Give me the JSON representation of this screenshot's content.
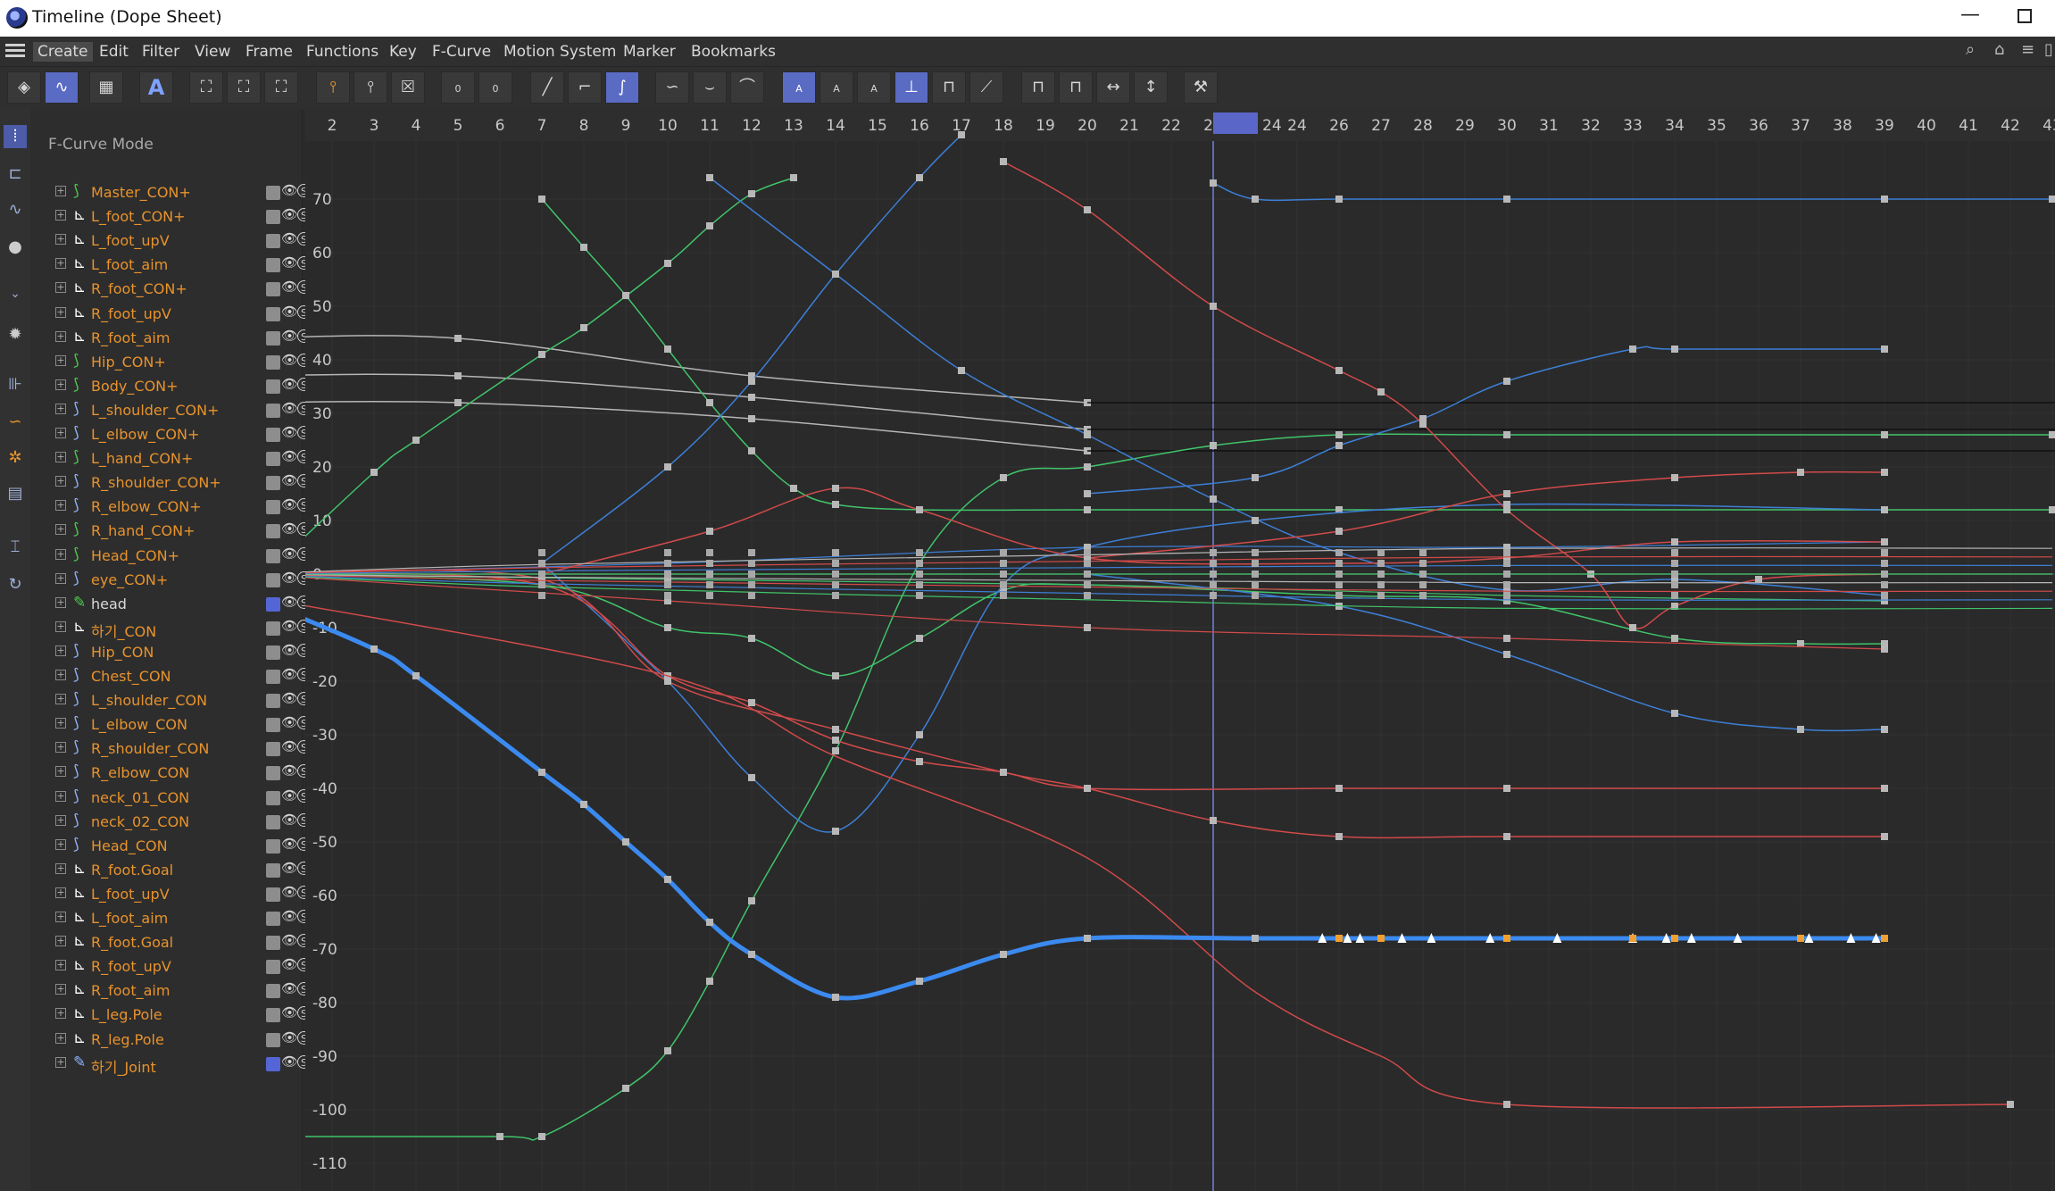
{
  "window": {
    "title": "Timeline (Dope Sheet)"
  },
  "menu": [
    "Create",
    "Edit",
    "Filter",
    "View",
    "Frame",
    "Functions",
    "Key",
    "F-Curve",
    "Motion System",
    "Marker",
    "Bookmarks"
  ],
  "panel": {
    "mode_label": "F-Curve Mode",
    "tracks": [
      {
        "name": "Master_CON+",
        "icon": "spline-icon",
        "color": "#4ccc4c",
        "sq": "grey"
      },
      {
        "name": "L_foot_CON+",
        "icon": "null-icon",
        "color": "#ffffff",
        "sq": "grey"
      },
      {
        "name": "L_foot_upV",
        "icon": "null-icon",
        "color": "#ffffff",
        "sq": "grey"
      },
      {
        "name": "L_foot_aim",
        "icon": "null-icon",
        "color": "#ffffff",
        "sq": "grey"
      },
      {
        "name": "R_foot_CON+",
        "icon": "null-icon",
        "color": "#ffffff",
        "sq": "grey"
      },
      {
        "name": "R_foot_upV",
        "icon": "null-icon",
        "color": "#ffffff",
        "sq": "grey"
      },
      {
        "name": "R_foot_aim",
        "icon": "null-icon",
        "color": "#ffffff",
        "sq": "grey"
      },
      {
        "name": "Hip_CON+",
        "icon": "spline-icon",
        "color": "#4ccc4c",
        "sq": "grey"
      },
      {
        "name": "Body_CON+",
        "icon": "spline-icon",
        "color": "#4ccc4c",
        "sq": "grey"
      },
      {
        "name": "L_shoulder_CON+",
        "icon": "spline-icon",
        "color": "#8fb4ff",
        "sq": "grey"
      },
      {
        "name": "L_elbow_CON+",
        "icon": "spline-icon",
        "color": "#8fb4ff",
        "sq": "grey"
      },
      {
        "name": "L_hand_CON+",
        "icon": "spline-icon",
        "color": "#4ccc4c",
        "sq": "grey"
      },
      {
        "name": "R_shoulder_CON+",
        "icon": "spline-icon",
        "color": "#8fb4ff",
        "sq": "grey"
      },
      {
        "name": "R_elbow_CON+",
        "icon": "spline-icon",
        "color": "#8fb4ff",
        "sq": "grey"
      },
      {
        "name": "R_hand_CON+",
        "icon": "spline-icon",
        "color": "#4ccc4c",
        "sq": "grey"
      },
      {
        "name": "Head_CON+",
        "icon": "spline-icon",
        "color": "#4ccc4c",
        "sq": "grey"
      },
      {
        "name": "eye_CON+",
        "icon": "spline-icon",
        "color": "#8fb4ff",
        "sq": "grey"
      },
      {
        "name": "head",
        "icon": "joint-icon",
        "color": "#4ccc4c",
        "sq": "blue",
        "white": true
      },
      {
        "name": "하기_CON",
        "icon": "null-icon",
        "color": "#ffffff",
        "sq": "grey"
      },
      {
        "name": "Hip_CON",
        "icon": "spline-icon",
        "color": "#8fb4ff",
        "sq": "grey"
      },
      {
        "name": "Chest_CON",
        "icon": "spline-icon",
        "color": "#8fb4ff",
        "sq": "grey"
      },
      {
        "name": "L_shoulder_CON",
        "icon": "spline-icon",
        "color": "#8fb4ff",
        "sq": "grey"
      },
      {
        "name": "L_elbow_CON",
        "icon": "spline-icon",
        "color": "#8fb4ff",
        "sq": "grey"
      },
      {
        "name": "R_shoulder_CON",
        "icon": "spline-icon",
        "color": "#8fb4ff",
        "sq": "grey"
      },
      {
        "name": "R_elbow_CON",
        "icon": "spline-icon",
        "color": "#8fb4ff",
        "sq": "grey"
      },
      {
        "name": "neck_01_CON",
        "icon": "spline-icon",
        "color": "#8fb4ff",
        "sq": "grey"
      },
      {
        "name": "neck_02_CON",
        "icon": "spline-icon",
        "color": "#8fb4ff",
        "sq": "grey"
      },
      {
        "name": "Head_CON",
        "icon": "spline-icon",
        "color": "#8fb4ff",
        "sq": "grey"
      },
      {
        "name": "R_foot.Goal",
        "icon": "null-icon",
        "color": "#ffffff",
        "sq": "grey"
      },
      {
        "name": "L_foot_upV",
        "icon": "null-icon",
        "color": "#ffffff",
        "sq": "grey"
      },
      {
        "name": "L_foot_aim",
        "icon": "null-icon",
        "color": "#ffffff",
        "sq": "grey"
      },
      {
        "name": "R_foot.Goal",
        "icon": "null-icon",
        "color": "#ffffff",
        "sq": "grey"
      },
      {
        "name": "R_foot_upV",
        "icon": "null-icon",
        "color": "#ffffff",
        "sq": "grey"
      },
      {
        "name": "R_foot_aim",
        "icon": "null-icon",
        "color": "#ffffff",
        "sq": "grey"
      },
      {
        "name": "L_leg.Pole",
        "icon": "null-icon",
        "color": "#ffffff",
        "sq": "grey"
      },
      {
        "name": "R_leg.Pole",
        "icon": "null-icon",
        "color": "#ffffff",
        "sq": "grey"
      },
      {
        "name": "하기_Joint",
        "icon": "joint-icon",
        "color": "#8fb4ff",
        "sq": "blue"
      }
    ]
  },
  "timeline": {
    "frame_labels": [
      "2",
      "3",
      "4",
      "5",
      "6",
      "7",
      "8",
      "9",
      "10",
      "11",
      "12",
      "13",
      "14",
      "15",
      "16",
      "17",
      "18",
      "19",
      "20",
      "21",
      "22",
      "23",
      "",
      "24",
      "26",
      "27",
      "28",
      "29",
      "30",
      "31",
      "32",
      "33",
      "34",
      "35",
      "36",
      "37",
      "38",
      "39",
      "40",
      "41",
      "42",
      "43"
    ],
    "current_frame": "24",
    "value_labels": [
      "70",
      "60",
      "50",
      "40",
      "30",
      "20",
      "10",
      "0",
      "-10",
      "-20",
      "-30",
      "-40",
      "-50",
      "-60",
      "-70",
      "-80",
      "-90",
      "-100",
      "-110"
    ],
    "colors": {
      "red": "#d24a4a",
      "green": "#40c46a",
      "blue": "#3d7fd6",
      "grey": "#b5b5b5",
      "selected": "#3b8af0",
      "playhead": "#6f7fe0"
    }
  }
}
